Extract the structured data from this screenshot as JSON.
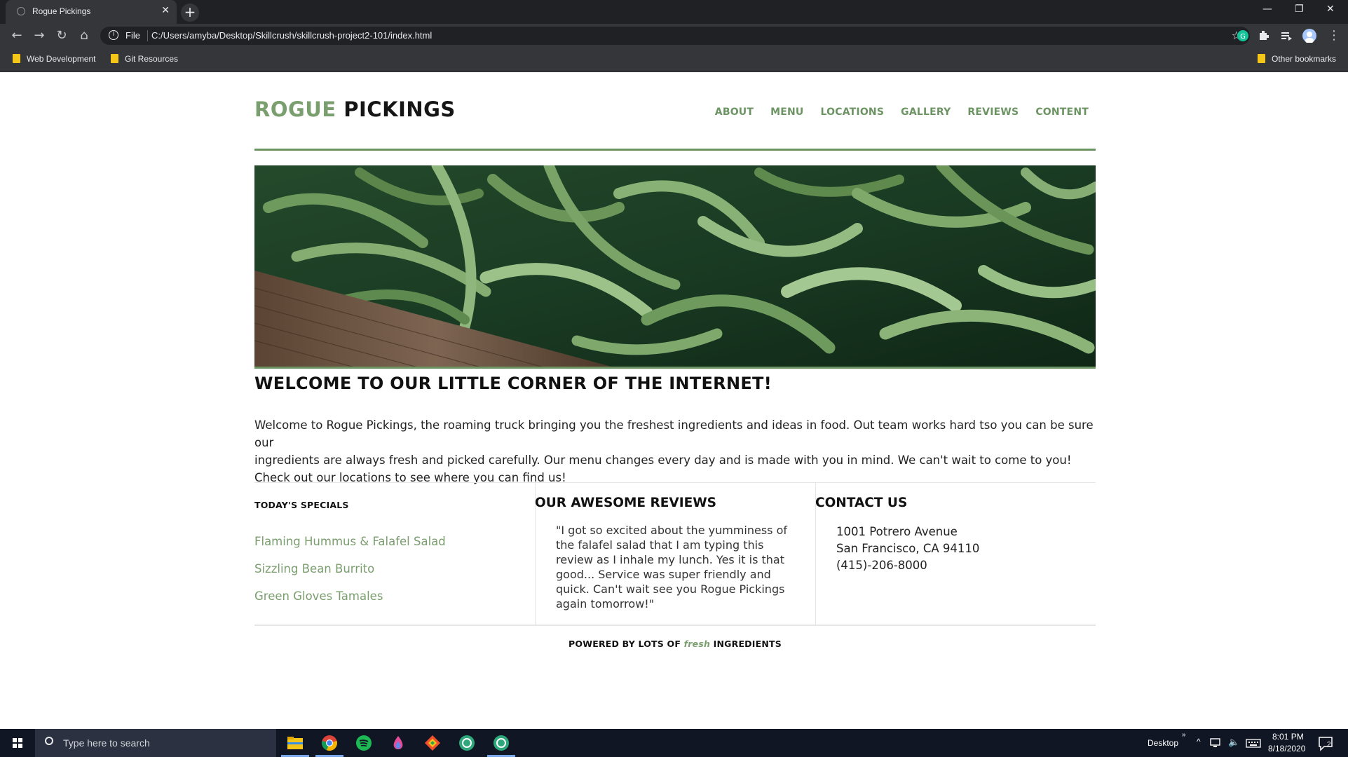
{
  "browser": {
    "tab_title": "Rogue Pickings",
    "new_tab": "+",
    "scheme_label": "File",
    "url": "C:/Users/amyba/Desktop/Skillcrush/skillcrush-project2-101/index.html",
    "bookmarks": [
      "Web Development",
      "Git Resources"
    ],
    "other_bookmarks": "Other bookmarks"
  },
  "site": {
    "brand_first": "ROGUE",
    "brand_second": "PICKINGS",
    "nav": [
      "ABOUT",
      "MENU",
      "LOCATIONS",
      "GALLERY",
      "REVIEWS",
      "CONTENT"
    ],
    "accent_color": "#7a9e6e"
  },
  "welcome": {
    "heading": "WELCOME TO OUR LITTLE CORNER OF THE INTERNET!",
    "line1": "Welcome to Rogue Pickings, the roaming truck bringing you the freshest ingredients and ideas in food. Out team works hard tso you can be sure our",
    "line2": "ingredients are always fresh and picked carefully. Our menu changes every day and is made with you in mind. We can't wait to come to you!",
    "line3": "Check out our locations to see where you can find us!"
  },
  "specials": {
    "title": "TODAY'S SPECIALS",
    "items": [
      "Flaming Hummus & Falafel Salad",
      "Sizzling Bean Burrito",
      "Green Gloves Tamales"
    ]
  },
  "reviews": {
    "title": "OUR AWESOME REVIEWS",
    "text": "\"I got so excited about the yumminess of the falafel salad that I am typing this review as I inhale my lunch. Yes it is that good... Service was super friendly and quick. Can't wait see you Rogue Pickings again tomorrow!\""
  },
  "contact": {
    "title": "CONTACT US",
    "address1": "1001 Potrero Avenue",
    "address2": "San Francisco, CA 94110",
    "phone": "(415)-206-8000"
  },
  "footer": {
    "prefix": "POWERED BY LOTS OF",
    "emphasis": "fresh",
    "suffix": "INGREDIENTS"
  },
  "taskbar": {
    "search_placeholder": "Type here to search",
    "desktop_label": "Desktop",
    "time": "8:01 PM",
    "date": "8/18/2020",
    "notifications": "2"
  }
}
